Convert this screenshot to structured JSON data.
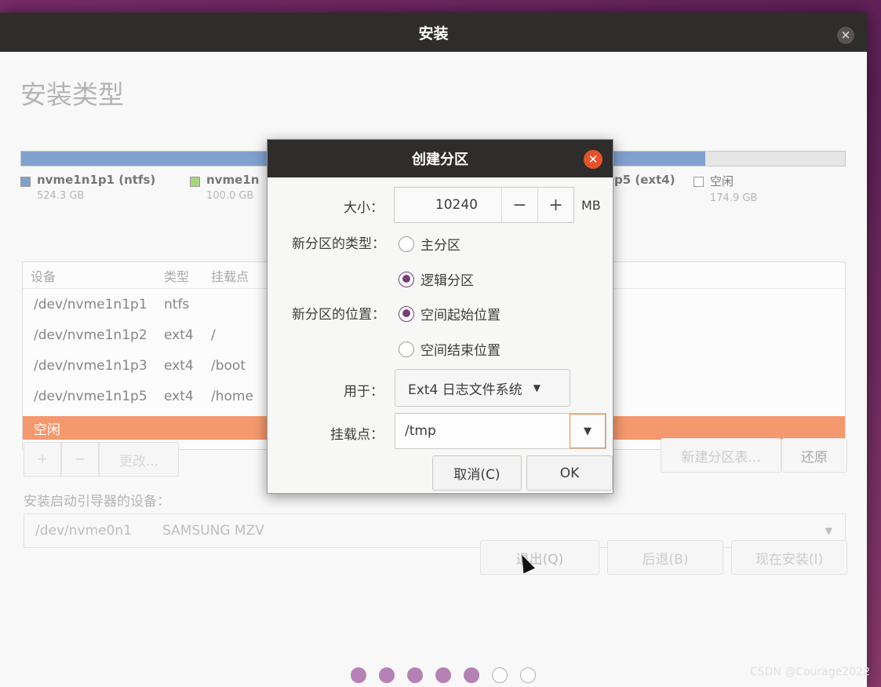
{
  "window": {
    "title": "安装",
    "close_glyph": "✕"
  },
  "page": {
    "title": "安装类型"
  },
  "disk_bar": {
    "segments": [
      {
        "color": "#3d6fb6",
        "fraction": 0.83
      },
      {
        "color": "#d9d9d9",
        "fraction": 0.17
      }
    ]
  },
  "legend": [
    {
      "name": "nvme1n1p1 (ntfs)",
      "size": "524.3 GB",
      "color": "#3d6fb6"
    },
    {
      "name": "nvme1n",
      "size": "100.0 GB",
      "color": "#7bbf3a"
    },
    {
      "name": "p5 (ext4)",
      "size": "",
      "color": ""
    },
    {
      "name": "空闲",
      "size": "174.9 GB",
      "color": "#ffffff"
    }
  ],
  "table": {
    "headers": {
      "device": "设备",
      "type": "类型",
      "mount": "挂载点"
    },
    "rows": [
      {
        "device": "/dev/nvme1n1p1",
        "type": "ntfs",
        "mount": ""
      },
      {
        "device": "/dev/nvme1n1p2",
        "type": "ext4",
        "mount": "/"
      },
      {
        "device": "/dev/nvme1n1p3",
        "type": "ext4",
        "mount": "/boot"
      },
      {
        "device": "/dev/nvme1n1p5",
        "type": "ext4",
        "mount": "/home"
      }
    ],
    "selected_row": "空闲"
  },
  "toolbar": {
    "add": "+",
    "remove": "−",
    "change": "更改...",
    "new_table": "新建分区表...",
    "revert": "还原"
  },
  "boot": {
    "label": "安装启动引导器的设备：",
    "device": "/dev/nvme0n1",
    "model": "SAMSUNG MZV"
  },
  "nav": {
    "quit": "退出(Q)",
    "back": "后退(B)",
    "install": "现在安装(I)"
  },
  "steps": {
    "total": 7,
    "done": 5
  },
  "watermark": "CSDN @Courage2022",
  "dialog": {
    "title": "创建分区",
    "close_glyph": "✕",
    "size_label": "大小：",
    "size_value": "10240",
    "minus": "−",
    "plus": "+",
    "unit": "MB",
    "type_label": "新分区的类型：",
    "type_primary": "主分区",
    "type_logical": "逻辑分区",
    "location_label": "新分区的位置：",
    "loc_start": "空间起始位置",
    "loc_end": "空间结束位置",
    "use_label": "用于：",
    "use_value": "Ext4 日志文件系统",
    "mount_label": "挂载点：",
    "mount_value": "/tmp",
    "cancel": "取消(C)",
    "ok": "OK"
  }
}
